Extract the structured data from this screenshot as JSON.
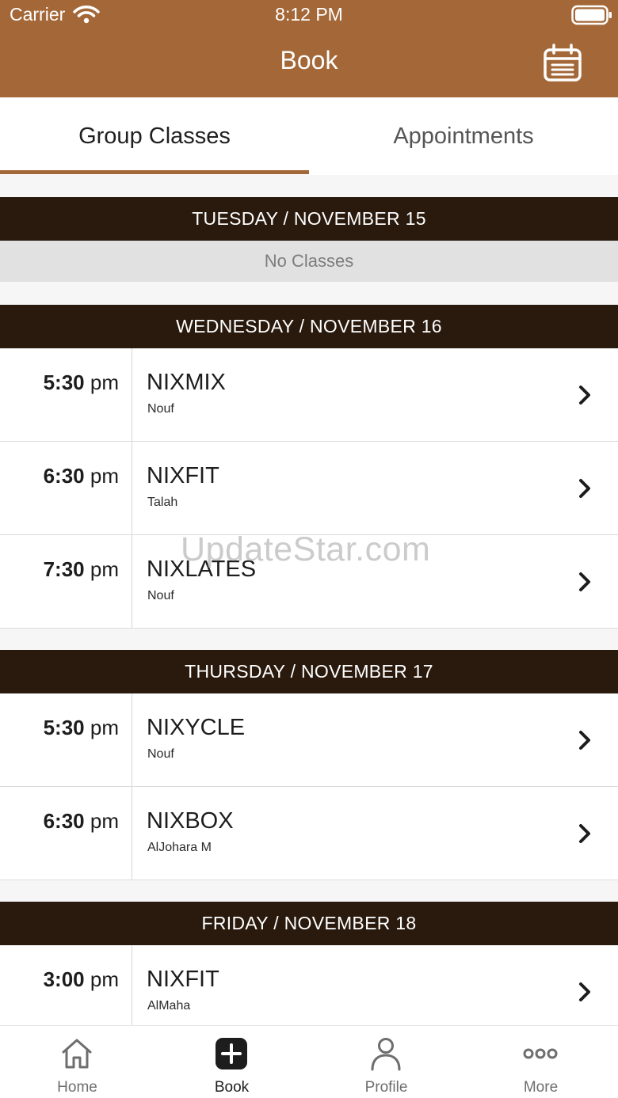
{
  "status_bar": {
    "carrier": "Carrier",
    "time": "8:12 PM"
  },
  "header": {
    "title": "Book",
    "action_icon": "calendar-icon"
  },
  "tabs": [
    {
      "label": "Group Classes",
      "selected": true
    },
    {
      "label": "Appointments",
      "selected": false
    }
  ],
  "days": [
    {
      "label": "TUESDAY / NOVEMBER 15",
      "empty_text": "No Classes",
      "classes": []
    },
    {
      "label": "WEDNESDAY / NOVEMBER 16",
      "classes": [
        {
          "time": "5:30",
          "ampm": "pm",
          "name": "NIXMIX",
          "instructor": "Nouf"
        },
        {
          "time": "6:30",
          "ampm": "pm",
          "name": "NIXFIT",
          "instructor": "Talah"
        },
        {
          "time": "7:30",
          "ampm": "pm",
          "name": "NIXLATES",
          "instructor": "Nouf"
        }
      ]
    },
    {
      "label": "THURSDAY / NOVEMBER 17",
      "classes": [
        {
          "time": "5:30",
          "ampm": "pm",
          "name": "NIXYCLE",
          "instructor": "Nouf"
        },
        {
          "time": "6:30",
          "ampm": "pm",
          "name": "NIXBOX",
          "instructor": "AlJohara M"
        }
      ]
    },
    {
      "label": "FRIDAY / NOVEMBER 18",
      "classes": [
        {
          "time": "3:00",
          "ampm": "pm",
          "name": "NIXFIT",
          "instructor": "AlMaha"
        }
      ]
    }
  ],
  "watermark": "UpdateStar.com",
  "tab_bar": [
    {
      "label": "Home",
      "icon": "home-icon",
      "active": false
    },
    {
      "label": "Book",
      "icon": "plus-icon",
      "active": true
    },
    {
      "label": "Profile",
      "icon": "person-icon",
      "active": false
    },
    {
      "label": "More",
      "icon": "more-icon",
      "active": false
    }
  ],
  "colors": {
    "brand": "#a46838",
    "day_header": "#2a1a0d",
    "empty_row": "#e1e1e1"
  }
}
